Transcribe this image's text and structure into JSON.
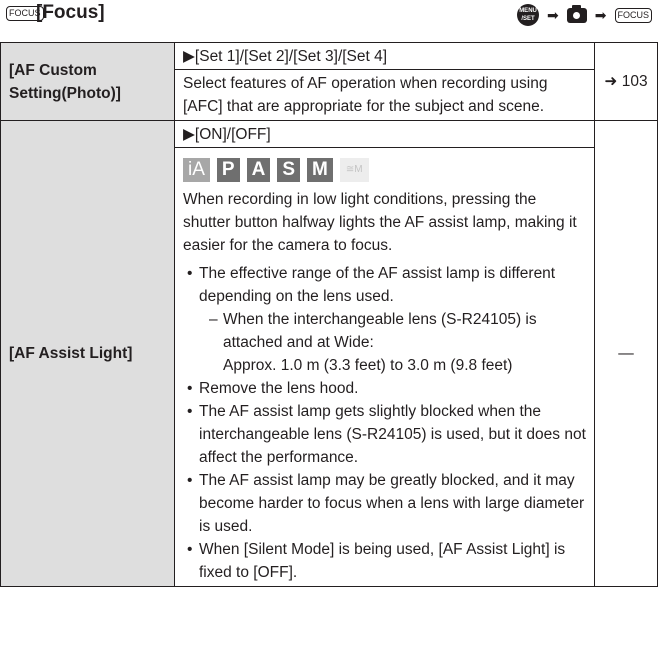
{
  "header": {
    "icon_text": "FOCUS",
    "title": "[Focus]",
    "menu_top": "MENU",
    "menu_bottom": "/SET",
    "arrow": "➡"
  },
  "rows": [
    {
      "name": "[AF Custom Setting(Photo)]",
      "settings": "▶[Set 1]/[Set 2]/[Set 3]/[Set 4]",
      "description": "Select features of AF operation when recording using [AFC] that are appropriate for the subject and scene.",
      "reference": "➜ 103"
    },
    {
      "name": "[AF Assist Light]",
      "settings": "▶[ON]/[OFF]",
      "modes": [
        "iA",
        "P",
        "A",
        "S",
        "M",
        "≅M"
      ],
      "description": "When recording in low light conditions, pressing the shutter button halfway lights the AF assist lamp, making it easier for the camera to focus.",
      "note1": "The effective range of the AF assist lamp is different depending on the lens used.",
      "note1_sub": "When the interchangeable lens (S-R24105) is attached and at Wide:",
      "note1_range": "Approx. 1.0 m (3.3 feet) to 3.0 m (9.8 feet)",
      "note2": "Remove the lens hood.",
      "note3": "The AF assist lamp gets slightly blocked when the interchangeable lens (S-R24105) is used, but it does not affect the performance.",
      "note4": "The AF assist lamp may be greatly blocked, and it may become harder to focus when a lens with large diameter is used.",
      "note5": "When [Silent Mode] is being used, [AF Assist Light] is fixed to [OFF].",
      "reference": "—"
    }
  ]
}
